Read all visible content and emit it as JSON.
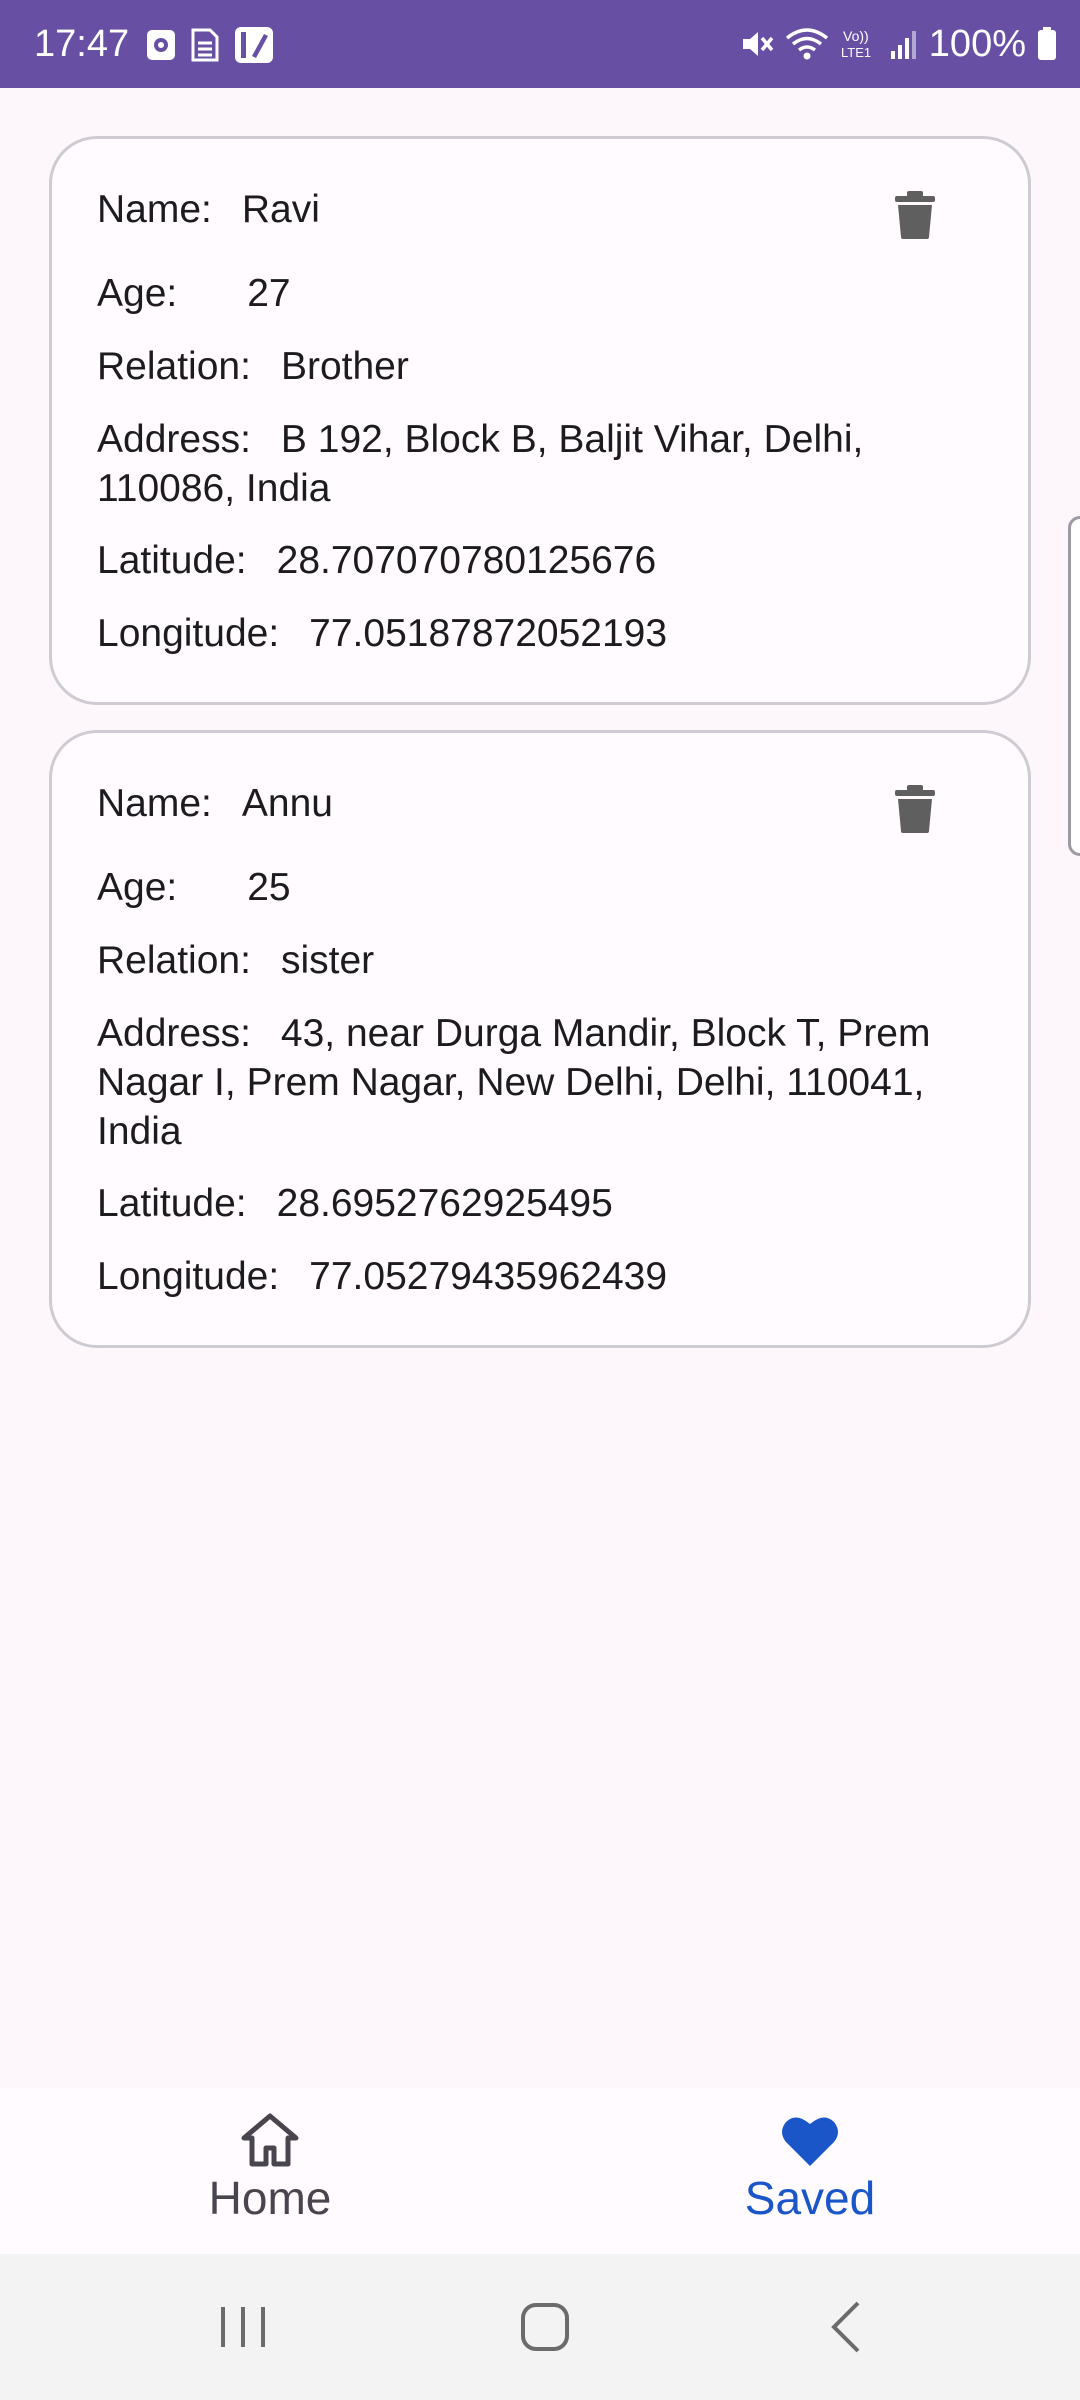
{
  "status_bar": {
    "time": "17:47",
    "battery": "100%",
    "left_icons": [
      "clock-notification-icon",
      "document-icon",
      "note-icon"
    ],
    "right_icons": [
      "mute-icon",
      "wifi-icon",
      "volte-icon",
      "signal-icon",
      "battery-icon"
    ],
    "background_color": "#6750a4"
  },
  "cards": [
    {
      "name_label": "Name:",
      "name": "Ravi",
      "age_label": "Age:",
      "age": "27",
      "relation_label": "Relation:",
      "relation": "Brother",
      "address_label": "Address:",
      "address_line1": "B 192, Block B, Baljit Vihar, Delhi,",
      "address_line2": "110086, India",
      "latitude_label": "Latitude:",
      "latitude": "28.707070780125676",
      "longitude_label": "Longitude:",
      "longitude": "77.05187872052193",
      "delete_icon": "trash-icon"
    },
    {
      "name_label": "Name:",
      "name": "Annu",
      "age_label": "Age:",
      "age": "25",
      "relation_label": "Relation:",
      "relation": "sister",
      "address_label": "Address:",
      "address_line1": "43, near Durga Mandir, Block T, Prem",
      "address_line2": "Nagar I, Prem Nagar, New Delhi, Delhi, 110041,",
      "address_line3": "India",
      "latitude_label": "Latitude:",
      "latitude": "28.6952762925495",
      "longitude_label": "Longitude:",
      "longitude": "77.05279435962439",
      "delete_icon": "trash-icon"
    }
  ],
  "bottom_nav": {
    "items": [
      {
        "label": "Home",
        "icon": "home-icon",
        "selected": false
      },
      {
        "label": "Saved",
        "icon": "heart-icon",
        "selected": true
      }
    ],
    "accent_color": "#1b56c8"
  },
  "system_nav": {
    "buttons": [
      "recents-button",
      "home-button",
      "back-button"
    ]
  }
}
